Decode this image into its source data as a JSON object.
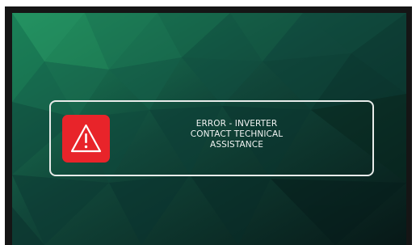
{
  "alert": {
    "icon": "warning-triangle-icon",
    "icon_color": "#e8242a",
    "lines": [
      "ERROR - INVERTER",
      "CONTACT TECHNICAL",
      "ASSISTANCE"
    ]
  },
  "theme": {
    "background": "dark green polygon pattern",
    "text_color": "#f2f4f3",
    "border_color": "#e8ecea"
  }
}
